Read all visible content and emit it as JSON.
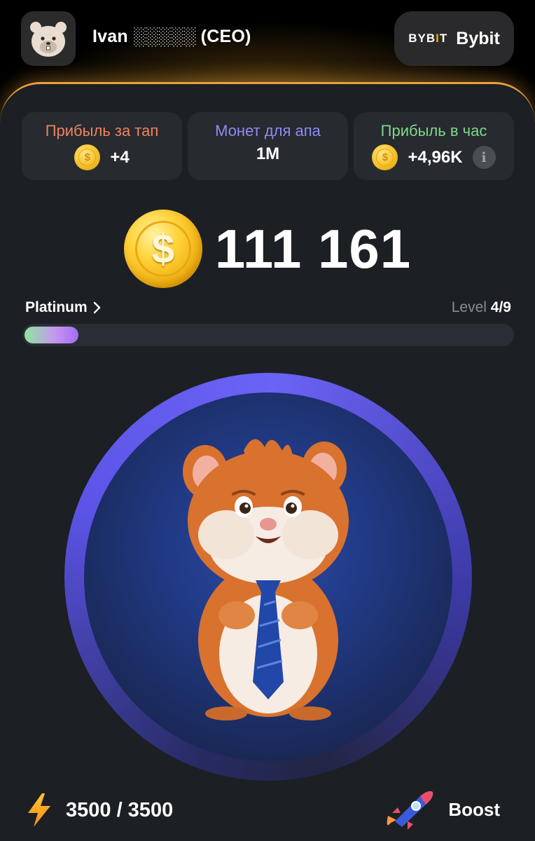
{
  "header": {
    "username": "Ivan ░░░░░ (CEO)",
    "exchange_logo_left": "BYB",
    "exchange_logo_bar": "I",
    "exchange_logo_right": "T",
    "exchange_name": "Bybit"
  },
  "stats": [
    {
      "label": "Прибыль за тап",
      "value": "+4",
      "label_color": "#f0835f",
      "icon": "coin-icon"
    },
    {
      "label": "Монет для апа",
      "value": "1M",
      "label_color": "#8d8cf5",
      "icon": ""
    },
    {
      "label": "Прибыль в час",
      "value": "+4,96K",
      "label_color": "#7ed98a",
      "icon": "coin-icon"
    }
  ],
  "balance": "111 161",
  "league": {
    "name": "Platinum",
    "level_label": "Level",
    "level_value": "4/9",
    "progress": 0.11
  },
  "energy": {
    "value": "3500 / 3500"
  },
  "boost": {
    "label": "Boost"
  },
  "coin_symbol": "$",
  "info_symbol": "i",
  "colors": {
    "accent": "#e8a23a",
    "panel": "#1c1f24",
    "card": "#272a2f",
    "ring": "#5b54e6"
  }
}
